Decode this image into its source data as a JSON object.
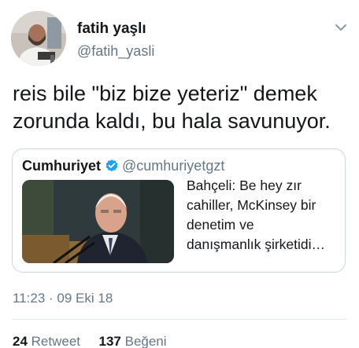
{
  "author": {
    "display_name": "fatih yaşlı",
    "handle": "@fatih_yasli"
  },
  "tweet": {
    "text": "reis bile \"biz bize yeteriz\" demek\nzorunda kaldı, bu hala savunuyor."
  },
  "quoted_tweet": {
    "name": "Cumhuriyet",
    "handle": "@cumhuriyetgzt",
    "text": "Bahçeli: Be hey zır\ncahiller, McKinsey bir\ndenetim ve\ndanışmanlık şirketidi…"
  },
  "meta": {
    "timestamp": "11:23 · 09 Eki 18"
  },
  "stats": {
    "retweets_count": "24",
    "retweets_label": "Retweet",
    "likes_count": "137",
    "likes_label": "Beğeni"
  },
  "colors": {
    "text": "#14171a",
    "secondary": "#657786",
    "border": "#ccd6dd",
    "verified": "#1da1f2"
  },
  "icons": {
    "caret": "chevron-down-icon",
    "verified": "verified-badge-icon"
  }
}
